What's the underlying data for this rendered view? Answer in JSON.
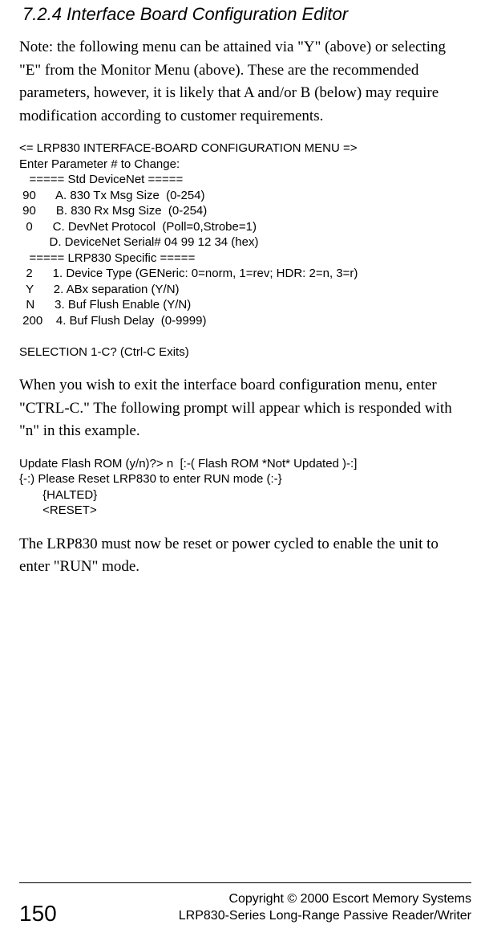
{
  "heading": "7.2.4  Interface Board Configuration Editor",
  "para1": "Note: the following menu can be attained via \"Y\" (above) or selecting \"E\" from the Monitor Menu (above).  These are the recommended parameters, however, it is likely that A and/or B (below) may require modification according to customer requirements.",
  "terminal1": "<= LRP830 INTERFACE-BOARD CONFIGURATION MENU =>\nEnter Parameter # to Change:\n   ===== Std DeviceNet =====\n 90      A. 830 Tx Msg Size  (0-254)\n 90      B. 830 Rx Msg Size  (0-254)\n  0      C. DevNet Protocol  (Poll=0,Strobe=1)\n         D. DeviceNet Serial# 04 99 12 34 (hex)\n   ===== LRP830 Specific =====\n  2      1. Device Type (GENeric: 0=norm, 1=rev; HDR: 2=n, 3=r)\n  Y      2. ABx separation (Y/N)\n  N      3. Buf Flush Enable (Y/N)\n 200    4. Buf Flush Delay  (0-9999)\n\nSELECTION 1-C? (Ctrl-C Exits)",
  "para2": "When you wish to exit the interface board configuration menu, enter \"CTRL-C.\" The following prompt will appear which is responded with \"n\" in this  example.",
  "terminal2": "Update Flash ROM (y/n)?> n  [:-( Flash ROM *Not* Updated )-:]\n{-:) Please Reset LRP830 to enter RUN mode (:-}\n       {HALTED}\n       <RESET>",
  "para3": "The LRP830 must now be reset or power cycled to enable the unit to enter \"RUN\" mode.",
  "footer": {
    "page": "150",
    "copyright": "Copyright © 2000 Escort Memory Systems",
    "product": "LRP830-Series Long-Range Passive Reader/Writer"
  }
}
